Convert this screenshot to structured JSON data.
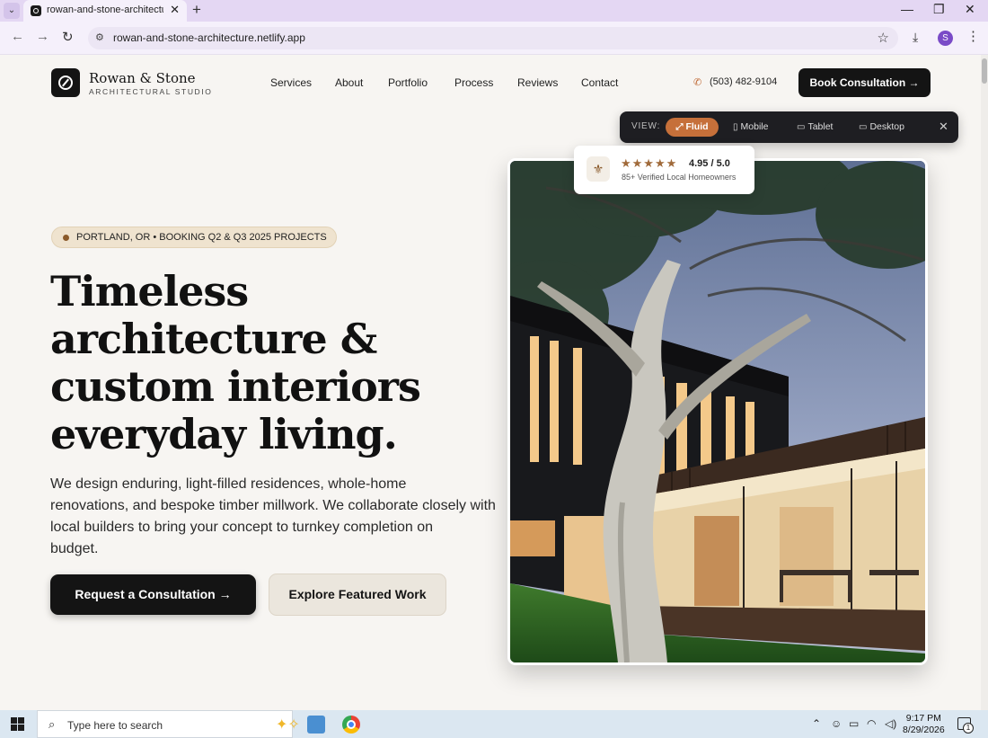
{
  "browser": {
    "tab_title": "rowan-and-stone-architecture",
    "url": "rowan-and-stone-architecture.netlify.app",
    "profile_initial": "S"
  },
  "site": {
    "brand_name": "Rowan & Stone",
    "brand_subtitle": "ARCHITECTURAL STUDIO",
    "nav": [
      "Services",
      "About",
      "Portfolio",
      "Process",
      "Reviews",
      "Contact"
    ],
    "phone": "(503) 482-9104",
    "book_label": "Book Consultation →"
  },
  "viewbar": {
    "label": "VIEW:",
    "options": [
      "Fluid",
      "Mobile",
      "Tablet",
      "Desktop"
    ],
    "active": "Fluid"
  },
  "hero": {
    "badge": "PORTLAND, OR • BOOKING Q2 & Q3 2025 PROJECTS",
    "headline_lines": [
      "Timeless",
      "architecture &",
      "custom interiors",
      "everyday living."
    ],
    "lede_lines": [
      "We design enduring, light-filled residences, whole-home",
      "renovations, and bespoke timber millwork. We collaborate closely with",
      "local builders to bring your concept to turnkey completion on",
      "budget."
    ],
    "cta_primary": "Request a Consultation →",
    "cta_secondary": "Explore Featured Work"
  },
  "rating": {
    "stars": "★★★★★",
    "score": "4.95 / 5.0",
    "caption": "85+ Verified Local Homeowners"
  },
  "taskbar": {
    "search_placeholder": "Type here to search",
    "time": "9:17 PM",
    "date": "8/29/2026",
    "notification_count": "1"
  }
}
